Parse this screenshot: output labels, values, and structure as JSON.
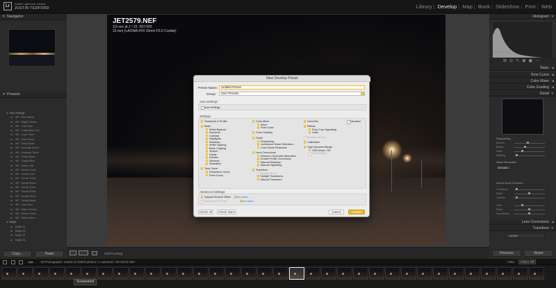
{
  "brand": {
    "app": "Adobe Lightroom Classic",
    "user": "JUSTIN TEDFORD",
    "logo": "Lr"
  },
  "modules": [
    "Library",
    "Develop",
    "Map",
    "Book",
    "Slideshow",
    "Print",
    "Web"
  ],
  "active_module": "Develop",
  "left_panel": {
    "navigator": "Navigator",
    "presets": "Presets",
    "preset_items": [
      "Auto Settings",
      "WP - Blue Winter",
      "WP - Bright Greens",
      "WP - Cold Tone",
      "WP - Crispy Blue Hue",
      "WP - Cyan Hued",
      "WP - Dark Wood",
      "WP - Deep Blues",
      "WP - Dramatic Wood",
      "WP - Dramatic Tones",
      "WP - Frosty Blues",
      "WP - Glacial Blue",
      "WP - Matte Cold",
      "WP - Muted Tones",
      "WP - Nordic Cool",
      "WP - Nordic Green",
      "WP - Nordic Blues",
      "WP - Nordic Grain",
      "WP - Nordic White",
      "WP - Nordic Wood",
      "WP - Spring Blues",
      "WP - Teal Land",
      "WP - Warm Greens",
      "WP - Winter Green",
      "WP - Winter Moss"
    ],
    "folder2": "Bright",
    "subitems": [
      "Bright 01",
      "Bright 02",
      "Bright 03",
      "Bright 04",
      "Bright 05",
      "Bright 06"
    ],
    "copy_button": "Copy...",
    "paste_button": "Paste"
  },
  "photo_info": {
    "filename": "JET2579.NEF",
    "line1": "1/3 sec at ƒ / 22, ISO 500",
    "line2": "15 mm (LAOWA FFII 15mm F5.0 Cookie)"
  },
  "dialog": {
    "title": "New Develop Preset",
    "preset_name_label": "Preset Name:",
    "preset_name_value": "Untitled Preset",
    "group_label": "Group:",
    "group_value": "User Presets",
    "auto_settings_section": "Auto Settings",
    "auto_settings_item": "Auto Settings",
    "settings_section": "Settings",
    "col1": [
      "Treatment & Profile",
      "Basic",
      "White Balance",
      "Exposure",
      "Contrast",
      "Highlights",
      "Shadows",
      "White Clipping",
      "Black Clipping",
      "Texture",
      "Clarity",
      "Dehaze",
      "Vibrance",
      "Saturation",
      "Tone Curve",
      "Parametric Curve",
      "Point Curve"
    ],
    "col2": [
      "Color Mixer",
      "Mixer",
      "Point Color",
      "Color Grading",
      "Detail",
      "Sharpening",
      "Luminance Noise Reduction",
      "Color Noise Reduction",
      "Lens Corrections",
      "Remove Chromatic Aberration",
      "Enable Profile Corrections",
      "Manual Distortion",
      "Manual Vignetting",
      "Transform",
      "Upright Mode",
      "Upright Transforms",
      "Manual Transform"
    ],
    "col3": [
      "Lens Blur",
      "Effects",
      "Post-Crop Vignetting",
      "Grain",
      "Process Version",
      "Calibration",
      "High Dynamic Range",
      "HDR Mode: Off",
      "HDR Editing"
    ],
    "visualize": "Visualize",
    "advanced_section": "Advanced Settings",
    "support_amount_slider": "Support Amount Slider",
    "create_hdr": "Create HDR Preset",
    "learn_more": "Learn more...",
    "check_all": "Check All",
    "check_none": "Check None",
    "cancel": "Cancel",
    "create": "Create"
  },
  "right_panel": {
    "histogram": "Histogram",
    "original_photo": "Original Photo",
    "basic": "Basic",
    "tone_curve": "Tone Curve",
    "color_mixer": "Color Mixer",
    "color_grading": "Color Grading",
    "detail": "Detail",
    "sharpening": "Sharpening",
    "noise_reduction": "Noise Reduction",
    "denoise_button": "Denoise...",
    "manual_noise": "Manual Noise Reduction",
    "sliders": [
      "Amount",
      "Radius",
      "Detail",
      "Masking",
      "Luminance",
      "Detail",
      "Contrast",
      "Color",
      "Detail",
      "Smoothness"
    ],
    "lens_corrections": "Lens Corrections",
    "transform": "Transform",
    "upright": "Upright",
    "previous_button": "Previous",
    "reset_button": "Reset"
  },
  "toolbar": {
    "soft_proofing": "Soft Proofing"
  },
  "filmstrip_header": {
    "source": "All Photographs",
    "count": "44502 of 44502 photos / 1 selected / JET2579.NEF",
    "filter_label": "Filter :",
    "filter_value": "Filters Off"
  },
  "tooltip": "Screenshot",
  "colors": {
    "accent": "#e7b930",
    "panel": "#2b2b2b",
    "dialog": "#ececec"
  }
}
